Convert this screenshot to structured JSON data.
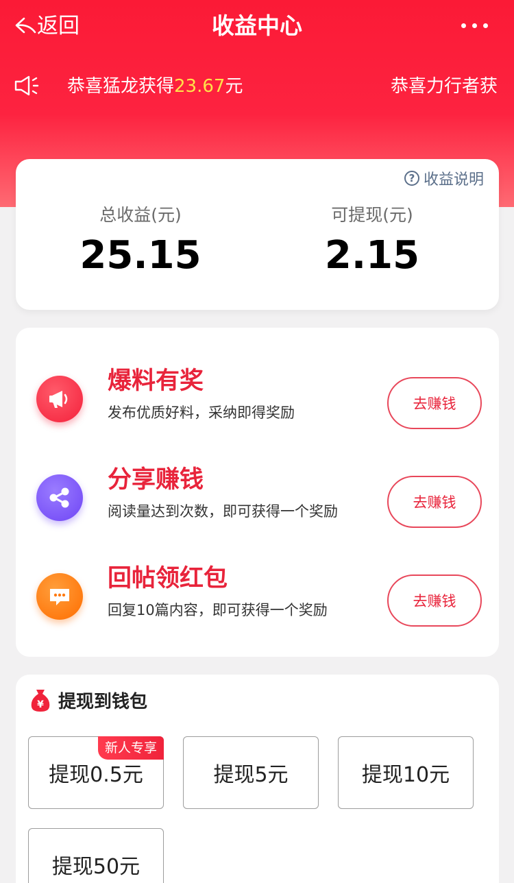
{
  "nav": {
    "back_label": "返回",
    "title": "收益中心"
  },
  "ticker": {
    "items": [
      {
        "prefix": "恭喜猛龙获得",
        "amount": "23.67",
        "suffix": "元"
      },
      {
        "prefix": "恭喜力行者获",
        "amount": "",
        "suffix": ""
      }
    ]
  },
  "balance": {
    "explain_label": "收益说明",
    "total_label": "总收益(元)",
    "total_value": "25.15",
    "withdrawable_label": "可提现(元)",
    "withdrawable_value": "2.15"
  },
  "tasks": [
    {
      "icon": "megaphone-icon",
      "title": "爆料有奖",
      "desc": "发布优质好料，采纳即得奖励",
      "button": "去赚钱",
      "color": "#f4213b"
    },
    {
      "icon": "share-icon",
      "title": "分享赚钱",
      "desc": "阅读量达到次数，即可获得一个奖励",
      "button": "去赚钱",
      "color": "#6f45f5"
    },
    {
      "icon": "chat-icon",
      "title": "回帖领红包",
      "desc": "回复10篇内容，即可获得一个奖励",
      "button": "去赚钱",
      "color": "#ff6d00"
    }
  ],
  "withdraw": {
    "title": "提现到钱包",
    "options": [
      {
        "label": "提现0.5元",
        "badge": "新人专享"
      },
      {
        "label": "提现5元"
      },
      {
        "label": "提现10元"
      },
      {
        "label": "提现50元"
      }
    ]
  },
  "colors": {
    "brand_red": "#fb1a36",
    "ticker_amount": "#ffe24a",
    "task_title": "#e8243b"
  }
}
